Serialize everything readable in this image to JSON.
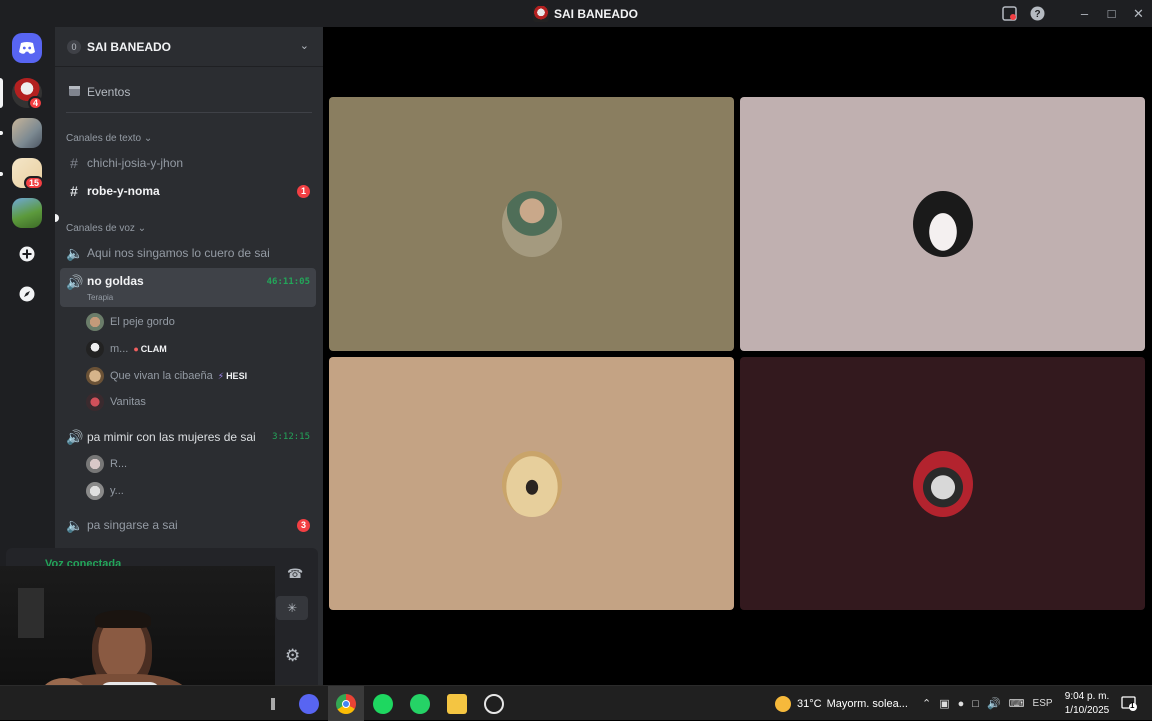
{
  "window": {
    "title": "SAI BANEADO"
  },
  "guilds": {
    "badges": [
      "4",
      "15"
    ]
  },
  "server": {
    "name": "SAI BANEADO",
    "boost_level": "0",
    "events_label": "Eventos"
  },
  "text_category": "Canales de texto",
  "text_channels": [
    {
      "name": "chichi-josia-y-jhon"
    },
    {
      "name": "robe-y-noma",
      "mentions": "1"
    }
  ],
  "voice_category": "Canales de voz",
  "voice_channels": [
    {
      "name": "Aqui nos singamos lo cuero de sai"
    },
    {
      "name": "no goldas",
      "status": "Terapia",
      "timer": "46:11:05",
      "members": [
        {
          "name": "El peje gordo"
        },
        {
          "name": "m...",
          "tag": "CLAM"
        },
        {
          "name": "Que vivan la cibaeña",
          "tag": "HESI"
        },
        {
          "name": "Vanitas"
        }
      ]
    },
    {
      "name": "pa mimir con las mujeres de sai",
      "timer": "3:12:15",
      "members": [
        {
          "name": "R..."
        },
        {
          "name": "y..."
        }
      ]
    },
    {
      "name": "pa singarse a sai",
      "mentions": "3"
    }
  ],
  "voice_panel": {
    "status": "Voz conectada"
  },
  "taskbar": {
    "weather_temp": "31°C",
    "weather_desc": "Mayorm. solea...",
    "language": "ESP",
    "time": "9:04 p. m.",
    "date": "1/10/2025",
    "notifications": "1"
  },
  "colors": {
    "tile_1": "#8a7e60",
    "tile_2": "#c0b0b0",
    "tile_3": "#c4a384",
    "tile_4": "#33191e",
    "accent_green": "#23a559",
    "mention_red": "#f23f43"
  }
}
